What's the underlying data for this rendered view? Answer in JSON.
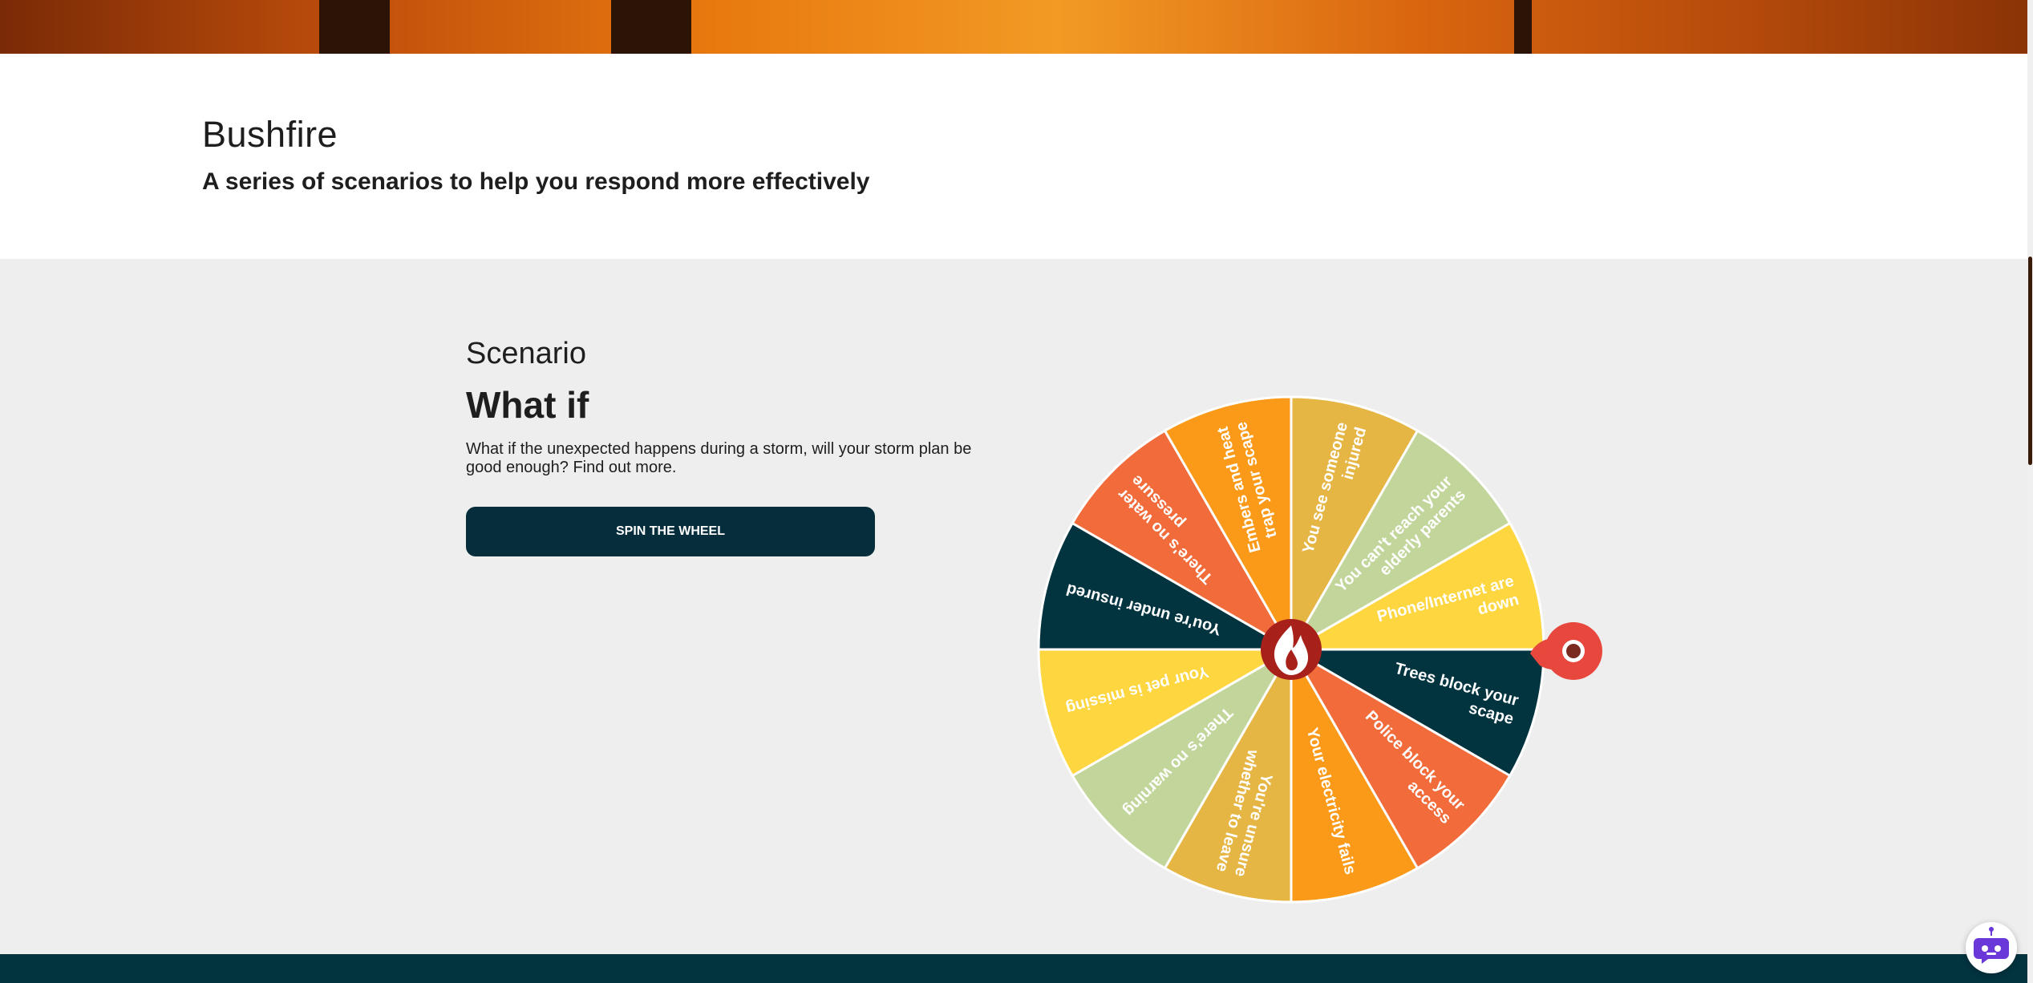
{
  "page": {
    "title": "Bushfire",
    "subtitle": "A series of scenarios to help you respond more effectively"
  },
  "scenario": {
    "eyebrow": "Scenario",
    "heading": "What if",
    "description": "What if the unexpected happens during a storm, will your storm plan be good enough? Find out more.",
    "spin_button_label": "SPIN THE WHEEL"
  },
  "wheel": {
    "center_icon": "flame-icon",
    "pointer_icon": "pointer-pin-icon",
    "colors": {
      "gold": "#e6b645",
      "sage": "#c2d69b",
      "yellow": "#fdd640",
      "navy": "#023440",
      "coral": "#f26b3a",
      "orange": "#fb9a18",
      "center": "#a8201a",
      "pointer": "#e8473d"
    },
    "segments": [
      {
        "label_lines": [
          "Trees block your",
          "scape"
        ],
        "color": "#023440"
      },
      {
        "label_lines": [
          "Police block your",
          "access"
        ],
        "color": "#f26b3a"
      },
      {
        "label_lines": [
          "Your electricity fails"
        ],
        "color": "#fb9a18"
      },
      {
        "label_lines": [
          "You're unsure",
          "whether to leave"
        ],
        "color": "#e6b645"
      },
      {
        "label_lines": [
          "There's no warning"
        ],
        "color": "#c2d69b"
      },
      {
        "label_lines": [
          "Your pet is missing"
        ],
        "color": "#fdd640"
      },
      {
        "label_lines": [
          "You're under insured"
        ],
        "color": "#023440"
      },
      {
        "label_lines": [
          "There's no water",
          "pressure"
        ],
        "color": "#f26b3a"
      },
      {
        "label_lines": [
          "Embers and heat",
          "trap your scape"
        ],
        "color": "#fb9a18"
      },
      {
        "label_lines": [
          "You see someone",
          "injured"
        ],
        "color": "#e6b645"
      },
      {
        "label_lines": [
          "You can't reach your",
          "elderly parents"
        ],
        "color": "#c2d69b"
      },
      {
        "label_lines": [
          "Phone/Internet are",
          "down"
        ],
        "color": "#fdd640"
      }
    ]
  },
  "chat": {
    "icon": "chatbot-icon",
    "color": "#6a37d8"
  }
}
